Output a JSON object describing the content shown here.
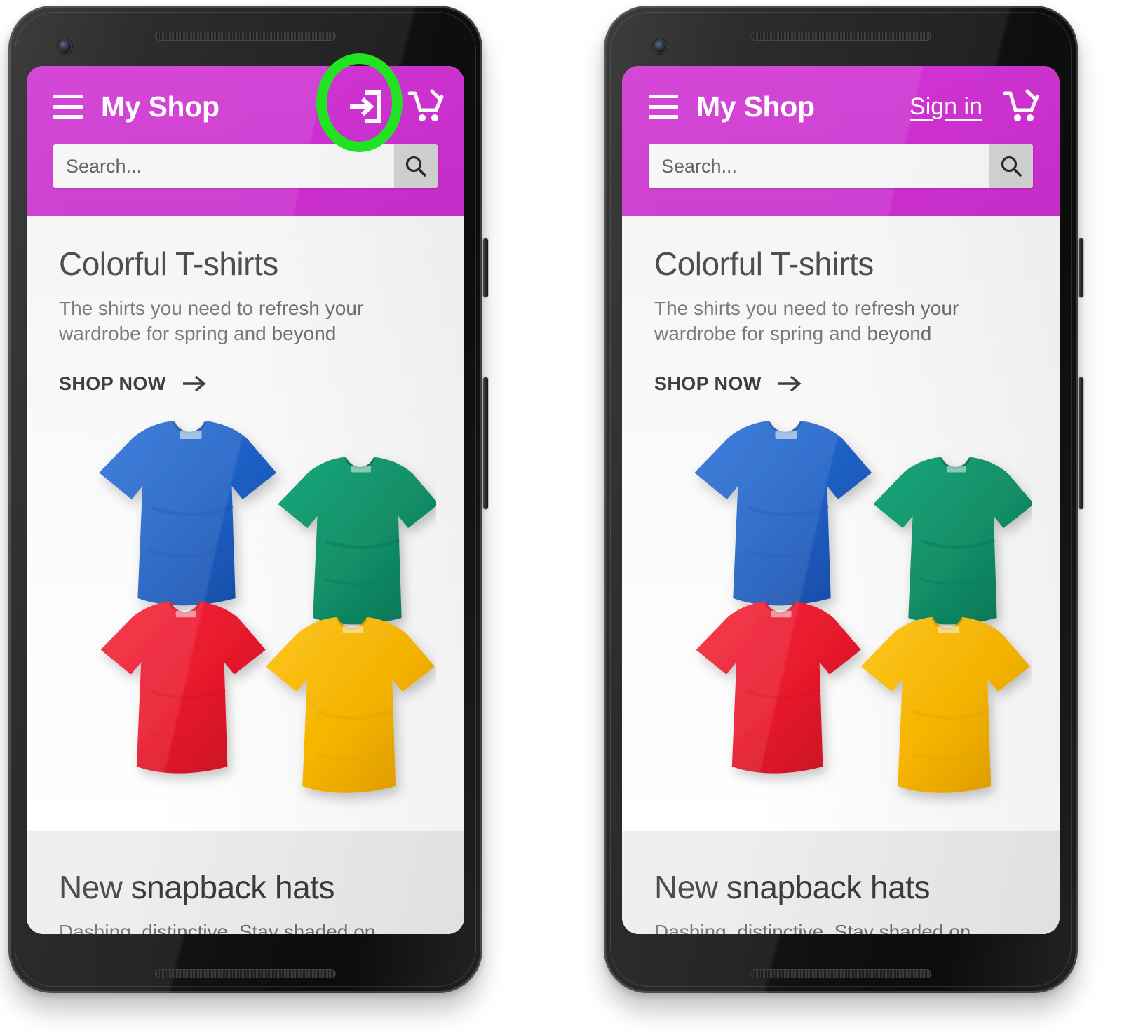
{
  "meta": {
    "screenshot_kind": "two-phone-mockup-comparison",
    "left_variant": "icon-login-button",
    "right_variant": "text-sign-in-link"
  },
  "colors": {
    "app_bar": "#CC2FD0",
    "highlight_ring": "#22E322",
    "phone_body": "#141414",
    "page_background": "#FFFFFF",
    "content_background": "#EEEEEE",
    "title_text": "#3C3C3C",
    "subtitle_text": "#6E6E6E",
    "shirt_blue": "#1E5FC4",
    "shirt_green": "#12926A",
    "shirt_red": "#E8192C",
    "shirt_yellow": "#FBB800"
  },
  "phones": [
    {
      "id": "left",
      "appbar": {
        "menu_icon": "hamburger-menu-icon",
        "title": "My Shop",
        "action": {
          "type": "icon",
          "icon": "login-icon",
          "label": ""
        },
        "cart_icon": "shopping-cart-icon"
      },
      "search": {
        "placeholder": "Search...",
        "value": "",
        "button_icon": "search-icon"
      },
      "cards": [
        {
          "title": "Colorful T-shirts",
          "subtitle": "The shirts you need to refresh your wardrobe for spring and beyond",
          "cta_label": "SHOP NOW",
          "cta_icon": "arrow-right-icon",
          "image": "four-colorful-tshirts-photo"
        },
        {
          "title": "New snapback hats",
          "subtitle": "Dashing, distinctive. Stay shaded on sunny"
        }
      ],
      "highlight": {
        "shape": "ellipse",
        "target": "login-icon"
      }
    },
    {
      "id": "right",
      "appbar": {
        "menu_icon": "hamburger-menu-icon",
        "title": "My Shop",
        "action": {
          "type": "text",
          "icon": "",
          "label": "Sign in"
        },
        "cart_icon": "shopping-cart-icon"
      },
      "search": {
        "placeholder": "Search...",
        "value": "",
        "button_icon": "search-icon"
      },
      "cards": [
        {
          "title": "Colorful T-shirts",
          "subtitle": "The shirts you need to refresh your wardrobe for spring and beyond",
          "cta_label": "SHOP NOW",
          "cta_icon": "arrow-right-icon",
          "image": "four-colorful-tshirts-photo"
        },
        {
          "title": "New snapback hats",
          "subtitle": "Dashing, distinctive. Stay shaded on sunny"
        }
      ],
      "highlight": {
        "shape": "circle",
        "target": "sign-in-link"
      }
    }
  ]
}
